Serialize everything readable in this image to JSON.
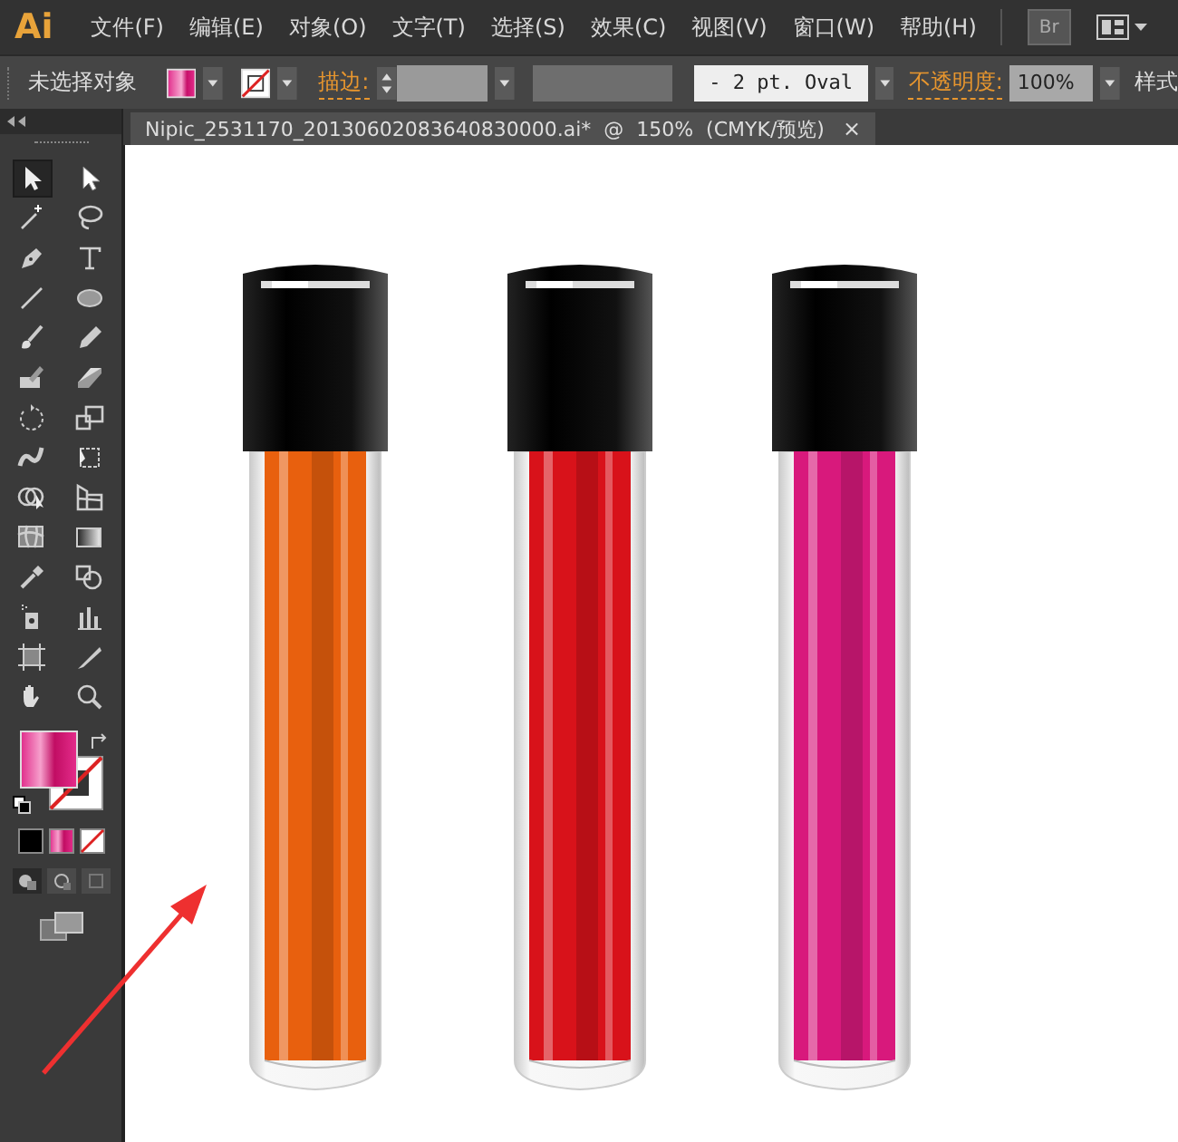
{
  "menu_bar": {
    "logo": "Ai",
    "menus": [
      "文件(F)",
      "编辑(E)",
      "对象(O)",
      "文字(T)",
      "选择(S)",
      "效果(C)",
      "视图(V)",
      "窗口(W)",
      "帮助(H)"
    ],
    "bridge_button": "Br"
  },
  "control_bar": {
    "selection_status": "未选择对象",
    "stroke_label": "描边:",
    "brush_definition": "- 2 pt. Oval",
    "opacity_label": "不透明度:",
    "opacity_value": "100%",
    "style_label": "样式"
  },
  "tools": [
    {
      "kind": "selection",
      "selected": true
    },
    {
      "kind": "direct-selection",
      "selected": false
    },
    {
      "kind": "magic-wand",
      "selected": false
    },
    {
      "kind": "lasso",
      "selected": false
    },
    {
      "kind": "pen",
      "selected": false
    },
    {
      "kind": "type",
      "selected": false
    },
    {
      "kind": "line",
      "selected": false
    },
    {
      "kind": "ellipse",
      "selected": false
    },
    {
      "kind": "brush",
      "selected": false
    },
    {
      "kind": "pencil",
      "selected": false
    },
    {
      "kind": "blob-brush",
      "selected": false
    },
    {
      "kind": "eraser",
      "selected": false
    },
    {
      "kind": "rotate",
      "selected": false
    },
    {
      "kind": "scale",
      "selected": false
    },
    {
      "kind": "warp",
      "selected": false
    },
    {
      "kind": "free-transform",
      "selected": false
    },
    {
      "kind": "shape-builder",
      "selected": false
    },
    {
      "kind": "perspective-grid",
      "selected": false
    },
    {
      "kind": "mesh",
      "selected": false
    },
    {
      "kind": "gradient",
      "selected": false
    },
    {
      "kind": "eyedropper",
      "selected": false
    },
    {
      "kind": "blend",
      "selected": false
    },
    {
      "kind": "symbol-sprayer",
      "selected": false
    },
    {
      "kind": "column-graph",
      "selected": false
    },
    {
      "kind": "artboard",
      "selected": false
    },
    {
      "kind": "slice",
      "selected": false
    },
    {
      "kind": "hand",
      "selected": false
    },
    {
      "kind": "zoom",
      "selected": false
    }
  ],
  "document_tab": {
    "title": "Nipic_2531170_20130602083640830000.ai*  @  150%  (CMYK/预览)",
    "close": "×"
  },
  "canvas": {
    "lip_glosses": [
      {
        "color": "#e8600e"
      },
      {
        "color": "#d8121a"
      },
      {
        "color": "#d8197c"
      }
    ]
  }
}
